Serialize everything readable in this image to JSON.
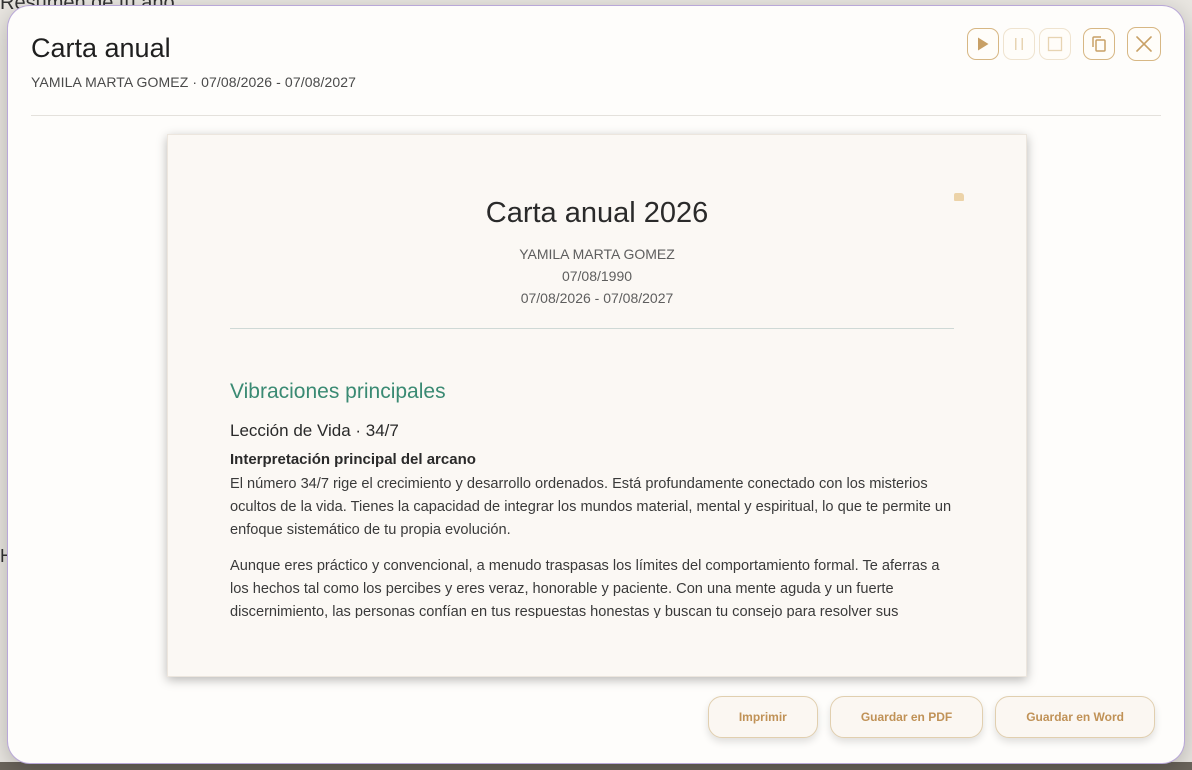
{
  "background": {
    "partial_title": "Resumen de tu año",
    "partial_letter": "H"
  },
  "modal": {
    "title": "Carta anual",
    "subtitle": "YAMILA MARTA GOMEZ · 07/08/2026 - 07/08/2027",
    "toolbar": [
      {
        "name": "play-icon",
        "enabled": true
      },
      {
        "name": "pause-icon",
        "enabled": false
      },
      {
        "name": "stop-icon",
        "enabled": false
      },
      {
        "name": "copy-icon",
        "enabled": true
      },
      {
        "name": "close-icon",
        "enabled": true
      }
    ]
  },
  "document": {
    "title": "Carta anual 2026",
    "person": "YAMILA MARTA GOMEZ",
    "birth_date": "07/08/1990",
    "period": "07/08/2026 - 07/08/2027",
    "section_title": "Vibraciones principales",
    "subsection_title": "Lección de Vida · 34/7",
    "subhead": "Interpretación principal del arcano",
    "paragraphs": [
      "El número 34/7 rige el crecimiento y desarrollo ordenados. Está profundamente conectado con los misterios ocultos de la vida. Tienes la capacidad de integrar los mundos material, mental y espiritual, lo que te permite un enfoque sistemático de tu propia evolución.",
      "Aunque eres práctico y convencional, a menudo traspasas los límites del comportamiento formal. Te aferras a los hechos tal como los percibes y eres veraz, honorable y paciente. Con una mente aguda y un fuerte discernimiento, las personas confían en tus respuestas honestas y buscan tu consejo para resolver sus"
    ]
  },
  "footer": {
    "print_label": "Imprimir",
    "pdf_label": "Guardar en PDF",
    "word_label": "Guardar en Word"
  },
  "colors": {
    "accent": "#c09257",
    "section": "#3a8a73",
    "modal_border": "#b9a8d8"
  }
}
